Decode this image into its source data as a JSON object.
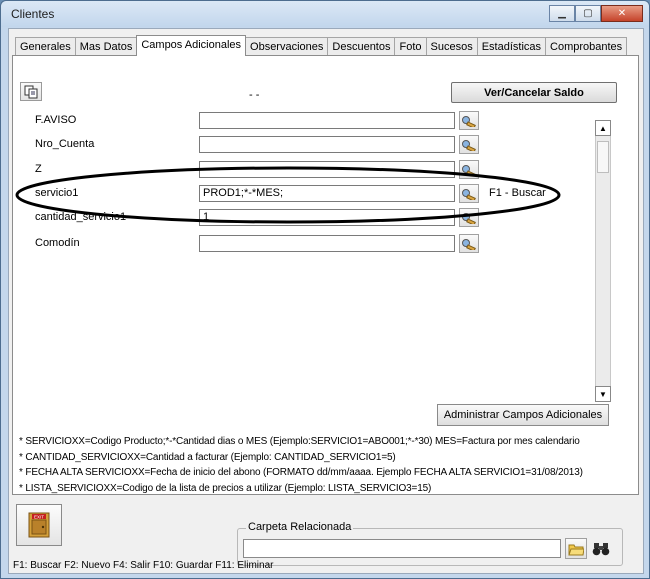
{
  "window": {
    "title": "Clientes",
    "buttons": [
      "minimize",
      "maximize",
      "close"
    ]
  },
  "tabs": [
    {
      "label": "Generales",
      "active": false
    },
    {
      "label": "Mas Datos",
      "active": false
    },
    {
      "label": "Campos Adicionales",
      "active": true
    },
    {
      "label": "Observaciones",
      "active": false
    },
    {
      "label": "Descuentos",
      "active": false
    },
    {
      "label": "Foto",
      "active": false
    },
    {
      "label": "Sucesos",
      "active": false
    },
    {
      "label": "Estadísticas",
      "active": false
    },
    {
      "label": "Comprobantes",
      "active": false
    }
  ],
  "header": {
    "dashes": "- -",
    "saldo_button": "Ver/Cancelar Saldo"
  },
  "fields": [
    {
      "label": "F.AVISO",
      "value": "",
      "hint": ""
    },
    {
      "label": "Nro_Cuenta",
      "value": "",
      "hint": ""
    },
    {
      "label": "Z",
      "value": "",
      "hint": ""
    },
    {
      "label": "servicio1",
      "value": "PROD1;*-*MES;",
      "hint": "F1 - Buscar"
    },
    {
      "label": "cantidad_servicio1",
      "value": "1",
      "hint": ""
    },
    {
      "label": "Comodín",
      "value": "",
      "hint": ""
    }
  ],
  "admin_button": "Administrar Campos Adicionales",
  "notes": [
    "* SERVICIOXX=Codigo Producto;*-*Cantidad dias o MES  (Ejemplo:SERVICIO1=ABO001;*-*30) MES=Factura por mes calendario",
    "* CANTIDAD_SERVICIOXX=Cantidad a facturar (Ejemplo: CANTIDAD_SERVICIO1=5)",
    "* FECHA ALTA SERVICIOXX=Fecha de inicio del abono  (FORMATO dd/mm/aaaa. Ejemplo FECHA ALTA SERVICIO1=31/08/2013)",
    "* LISTA_SERVICIOXX=Codigo de la lista de precios a utilizar (Ejemplo: LISTA_SERVICIO3=15)"
  ],
  "exit_label": "EXIT",
  "carpeta": {
    "label": "Carpeta Relacionada",
    "value": ""
  },
  "statusbar": "F1: Buscar  F2: Nuevo  F4: Salir  F10: Guardar  F11: Eliminar",
  "colors": {
    "titlebar": "#c8daee",
    "annotation_ellipse": "#000000",
    "exit_icon": "#d4a03a"
  }
}
